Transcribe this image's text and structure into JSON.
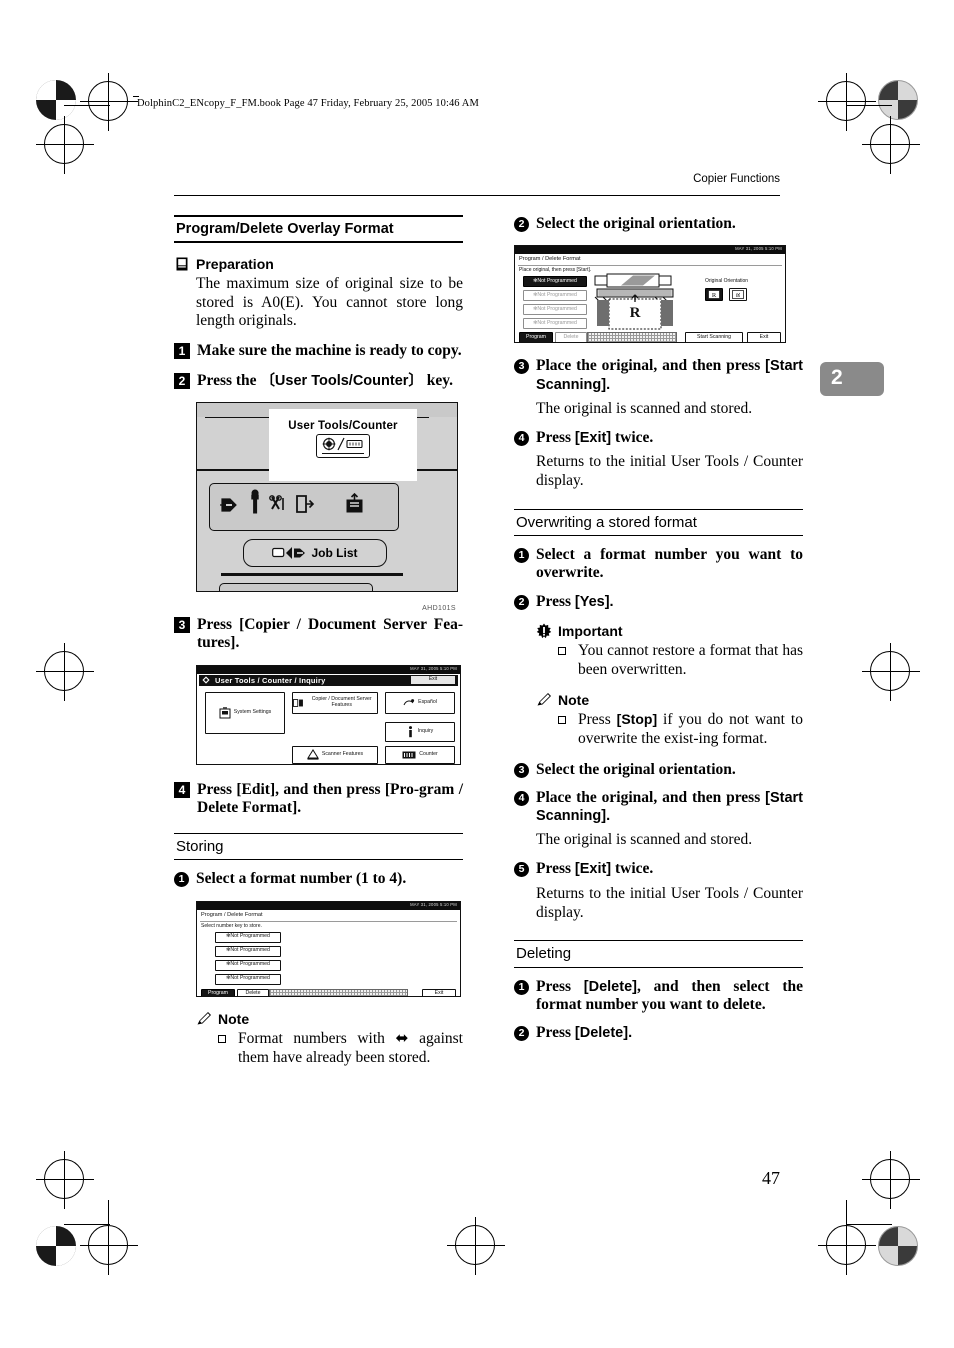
{
  "printer_slug": "DolphinC2_ENcopy_F_FM.book  Page 47  Friday, February 25, 2005  10:46 AM",
  "running_head": "Copier Functions",
  "chapter_tab": "2",
  "page_number": "47",
  "left_column": {
    "section_title": "Program/Delete Overlay Format",
    "preparation": {
      "label": "Preparation",
      "icon": "book-icon",
      "text": "The maximum size of original size to be stored is A0(E). You cannot store long length originals."
    },
    "steps": [
      {
        "num": "1",
        "text": "Make sure the machine is ready to copy."
      },
      {
        "num": "2",
        "text_before": "Press the ",
        "key": "〔User Tools/Counter〕",
        "text_after": " key."
      },
      {
        "num": "3",
        "text": "Press [Copier / Document Server Fea-tures]."
      },
      {
        "num": "4",
        "text": "Press [Edit], and then press [Pro-gram / Delete Format]."
      }
    ],
    "panel_figure": {
      "callout_label": "User Tools/Counter",
      "key_icon": "user-tools-counter-key-icon",
      "row_icons": [
        "data-in-icon",
        "maintenance-icon",
        "service-call-icon",
        "paper-exit-icon",
        "toner-add-icon"
      ],
      "job_list_label": "Job List",
      "figure_id": "AHD101S"
    },
    "lcd_user_tools": {
      "clock": "MAY  31, 2005  5:10 PM",
      "title": "User Tools / Counter / Inquiry",
      "exit_label": "Exit",
      "buttons": [
        "System Settings",
        "Copier / Document Server Features",
        "Español",
        "Inquiry",
        "Scanner Features",
        "Counter"
      ]
    },
    "storing_heading": "Storing",
    "storing_substeps": [
      {
        "num": "1",
        "text": "Select a format number (1 to 4)."
      }
    ],
    "lcd_program_delete": {
      "clock": "MAY  31, 2005  5:10 PM",
      "title": "Program / Delete Format",
      "prompt": "Select number key to store.",
      "format_buttons": [
        "✻Not Programmed",
        "✻Not Programmed",
        "✻Not Programmed",
        "✻Not Programmed"
      ],
      "softkeys": [
        "Program",
        "Delete"
      ],
      "exit_label": "Exit"
    },
    "note": {
      "label": "Note",
      "icon": "pencil-icon",
      "bullet": "Format numbers with ⬌ against them have already been stored."
    }
  },
  "right_column": {
    "substeps_top": [
      {
        "num": "2",
        "text": "Select the original orientation."
      }
    ],
    "lcd_orientation": {
      "clock": "MAY  31, 2005  5:10 PM",
      "title": "Program / Delete Format",
      "prompt": "Place original, then press [Start].",
      "format_buttons": [
        "✻Not Programmed",
        "✻Not Programmed",
        "✻Not Programmed",
        "✻Not Programmed"
      ],
      "orientation_label": "Original Orientation",
      "orientation_options": [
        "portrait-orientation-icon",
        "landscape-orientation-icon"
      ],
      "original_letter": "R",
      "softkeys": [
        "Program",
        "Delete"
      ],
      "start_scanning_label": "Start Scanning",
      "exit_label": "Exit"
    },
    "substeps_after_fig": [
      {
        "num": "3",
        "text_before": "Place the original, and then press ",
        "key": "[Start Scanning].",
        "body": "The original is scanned and stored."
      },
      {
        "num": "4",
        "text_before": "Press ",
        "key": "[Exit]",
        "text_after": " twice.",
        "body": "Returns to the initial User Tools / Counter display."
      }
    ],
    "overwriting": {
      "heading": "Overwriting a stored format",
      "substeps": [
        {
          "num": "1",
          "text": "Select a format number you want to overwrite."
        },
        {
          "num": "2",
          "text_before": "Press ",
          "key": "[Yes].",
          "text_after": ""
        }
      ],
      "important": {
        "label": "Important",
        "icon": "important-icon",
        "bullet": "You cannot restore a format that has been overwritten."
      },
      "note": {
        "label": "Note",
        "icon": "pencil-icon",
        "bullet_before": "Press ",
        "bullet_key": "[Stop]",
        "bullet_after": " if you do not want to overwrite the exist-ing format."
      },
      "substeps_tail": [
        {
          "num": "3",
          "text": "Select the original orientation."
        },
        {
          "num": "4",
          "text_before": "Place the original, and then press ",
          "key": "[Start Scanning].",
          "body": "The original is scanned and stored."
        },
        {
          "num": "5",
          "text_before": "Press ",
          "key": "[Exit]",
          "text_after": " twice.",
          "body": "Returns to the initial User Tools / Counter display."
        }
      ]
    },
    "deleting": {
      "heading": "Deleting",
      "substeps": [
        {
          "num": "1",
          "text_before": "Press ",
          "key": "[Delete]",
          "text_after": ", and then select the format number you want to delete."
        },
        {
          "num": "2",
          "text_before": "Press ",
          "key": "[Delete].",
          "text_after": ""
        }
      ]
    }
  }
}
